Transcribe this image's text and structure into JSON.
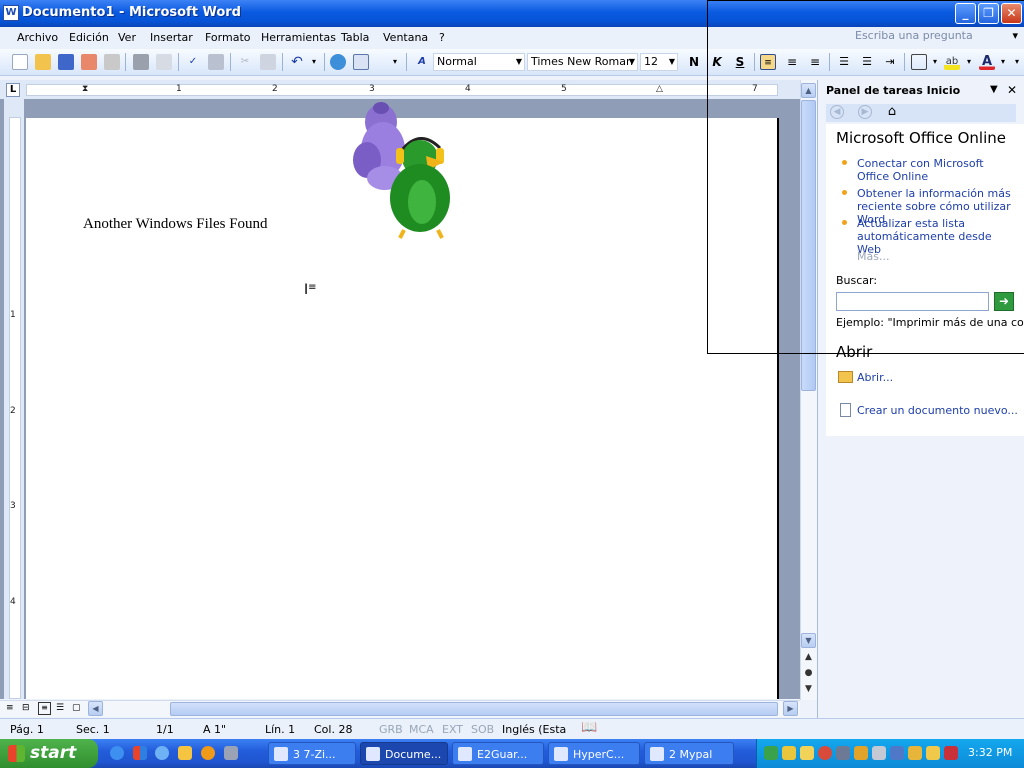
{
  "window": {
    "title": "Documento1 - Microsoft Word",
    "app_icon_label": "W"
  },
  "menubar": {
    "items": [
      {
        "label": "Archivo"
      },
      {
        "label": "Edición"
      },
      {
        "label": "Ver"
      },
      {
        "label": "Insertar"
      },
      {
        "label": "Formato"
      },
      {
        "label": "Herramientas"
      },
      {
        "label": "Tabla"
      },
      {
        "label": "Ventana"
      },
      {
        "label": "?"
      }
    ],
    "ask_placeholder": "Escriba una pregunta"
  },
  "toolbar": {
    "style": "Normal",
    "font": "Times New Roman",
    "size": "12",
    "bold_label": "N",
    "italic_label": "K",
    "underline_label": "S",
    "icons": [
      "new-icon",
      "open-icon",
      "save-icon",
      "permission-icon",
      "email-icon",
      "print-icon",
      "print-preview-icon",
      "spelling-icon",
      "research-icon",
      "cut-icon",
      "copy-icon",
      "paste-icon",
      "undo-icon",
      "hyperlink-icon",
      "table-icon",
      "styles-icon"
    ]
  },
  "ruler": {
    "numbers": [
      "1",
      "1",
      "2",
      "3",
      "4",
      "5",
      "6",
      "7"
    ],
    "tab_label": "L"
  },
  "vruler": {
    "numbers": [
      "1",
      "1",
      "2",
      "3",
      "4"
    ]
  },
  "document": {
    "text": "Another Windows Files Found"
  },
  "taskpane": {
    "title": "Panel de tareas Inicio",
    "online_heading": "Microsoft Office Online",
    "links": [
      "Conectar con Microsoft Office Online",
      "Obtener la información más reciente sobre cómo utilizar Word",
      "Actualizar esta lista automáticamente desde Web"
    ],
    "more": "Más...",
    "search_label": "Buscar:",
    "search_value": "",
    "example": "Ejemplo:  \"Imprimir más de una copia\"",
    "open_heading": "Abrir",
    "open_link": "Abrir...",
    "new_link": "Crear un documento nuevo..."
  },
  "statusbar": {
    "page": "Pág. 1",
    "section": "Sec. 1",
    "pages": "1/1",
    "at": "A 1\"",
    "line": "Lín. 1",
    "col": "Col. 28",
    "grb": "GRB",
    "mca": "MCA",
    "ext": "EXT",
    "sob": "SOB",
    "lang": "Inglés (Esta"
  },
  "taskbar": {
    "start": "start",
    "tasks": [
      {
        "label": "3 7-Zi..."
      },
      {
        "label": "Docume..."
      },
      {
        "label": "E2Guar..."
      },
      {
        "label": "HyperC..."
      },
      {
        "label": "2 Mypal"
      }
    ],
    "clock": "3:32 PM"
  },
  "colors": {
    "title_blue": "#0a5ae0",
    "taskbar_blue": "#235ddb",
    "start_green": "#3a9a37",
    "link_blue": "#1e3fa8"
  }
}
